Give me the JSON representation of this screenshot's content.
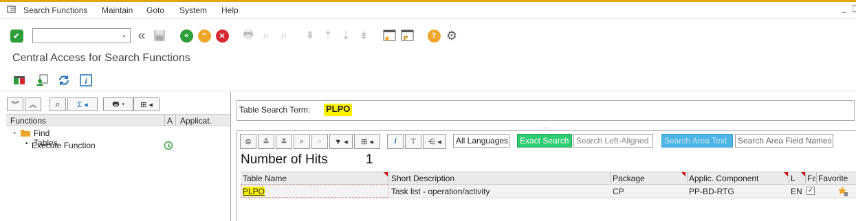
{
  "menu": {
    "items": [
      {
        "label": "Search Functions"
      },
      {
        "label": "Maintain"
      },
      {
        "label": "Goto"
      },
      {
        "label": "System"
      },
      {
        "label": "Help"
      }
    ]
  },
  "toolbar": {
    "command_value": ""
  },
  "page_title": "Central Access for Search Functions",
  "tree": {
    "headers": {
      "functions": "Functions",
      "a": "A",
      "applicat": "Applicat."
    },
    "nodes": [
      {
        "label": "Find Tables",
        "icon": "folder-icon"
      },
      {
        "label": "Execute Function",
        "icon": "execute-icon"
      }
    ]
  },
  "search": {
    "label": "Table Search Term:",
    "term": "PLPO"
  },
  "result_toolbar": {
    "all_languages": "All Languages",
    "exact_search": "Exact Search",
    "search_left_aligned": "Search Left-Aligned",
    "search_area_text": "Search Area Text",
    "search_area_field_names": "Search Area Field Names"
  },
  "hits": {
    "label": "Number of Hits",
    "count": "1"
  },
  "table": {
    "columns": {
      "table_name": "Table Name",
      "short_description": "Short Description",
      "package": "Package",
      "applic_component": "Applic. Component",
      "l": "L",
      "fa": "Fa",
      "favorite": "Favorite"
    },
    "rows": [
      {
        "table_name": "PLPO",
        "short_description": "Task list - operation/activity",
        "package": "CP",
        "applic_component": "PP-BD-RTG",
        "l": "EN",
        "fa_checked": true
      }
    ]
  },
  "colors": {
    "accent": "#e0a510",
    "highlight": "#fff200",
    "exact_search_bg": "#2ecc71",
    "confirm_green": "#2e9e3a",
    "cancel_red": "#d7282f",
    "up_orange": "#f0a52b"
  }
}
